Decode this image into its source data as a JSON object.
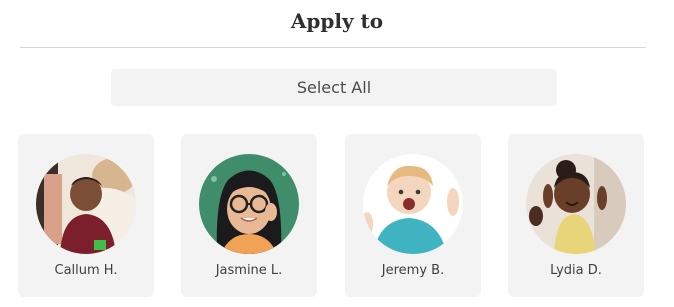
{
  "header": {
    "title": "Apply to"
  },
  "actions": {
    "select_all_label": "Select All"
  },
  "children": [
    {
      "name": "Callum H."
    },
    {
      "name": "Jasmine L."
    },
    {
      "name": "Jeremy B."
    },
    {
      "name": "Lydia D."
    }
  ],
  "colors": {
    "card_background": "#f3f3f3",
    "divider": "#d7d7d7",
    "text": "#3a3a3a"
  }
}
